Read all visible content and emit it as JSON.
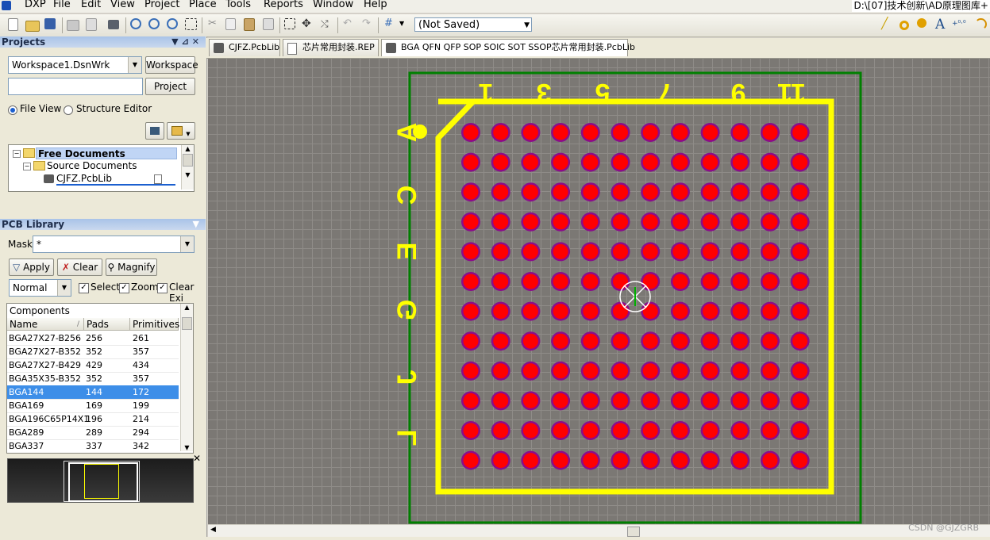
{
  "menubar": {
    "items": [
      "DXP",
      "File",
      "Edit",
      "View",
      "Project",
      "Place",
      "Tools",
      "Reports",
      "Window",
      "Help"
    ],
    "path": "D:\\[07]技术创新\\AD原理图库+"
  },
  "toolbar": {
    "status_value": "(Not Saved)"
  },
  "projects_panel": {
    "title": "Projects",
    "workspace_value": "Workspace1.DsnWrk",
    "workspace_button": "Workspace",
    "project_value": "",
    "project_button": "Project",
    "view_options": [
      "File View",
      "Structure Editor"
    ],
    "selected_view": "File View",
    "tree": [
      {
        "label": "Free Documents"
      },
      {
        "label": "Source Documents"
      },
      {
        "label": "CJFZ.PcbLib"
      }
    ]
  },
  "pcb_library_panel": {
    "title": "PCB Library",
    "mask_label": "Mask",
    "mask_value": "*",
    "apply_label": "Apply",
    "clear_label": "Clear",
    "magnify_label": "Magnify",
    "mode_value": "Normal",
    "checks": [
      {
        "label": "Select",
        "checked": true
      },
      {
        "label": "Zoom",
        "checked": true
      },
      {
        "label": "Clear Exi",
        "checked": true
      }
    ],
    "components_header": "Components",
    "columns": [
      "Name",
      "Pads",
      "Primitives"
    ],
    "rows": [
      {
        "name": "BGA27X27-B256",
        "pads": "256",
        "primitives": "261"
      },
      {
        "name": "BGA27X27-B352",
        "pads": "352",
        "primitives": "357"
      },
      {
        "name": "BGA27X27-B429",
        "pads": "429",
        "primitives": "434"
      },
      {
        "name": "BGA35X35-B352",
        "pads": "352",
        "primitives": "357"
      },
      {
        "name": "BGA144",
        "pads": "144",
        "primitives": "172"
      },
      {
        "name": "BGA169",
        "pads": "169",
        "primitives": "199"
      },
      {
        "name": "BGA196C65P14X1",
        "pads": "196",
        "primitives": "214"
      },
      {
        "name": "BGA289",
        "pads": "289",
        "primitives": "294"
      },
      {
        "name": "BGA337",
        "pads": "337",
        "primitives": "342"
      }
    ],
    "selected_row": "BGA144"
  },
  "tabs": [
    {
      "label": "CJFZ.PcbLib"
    },
    {
      "label": "芯片常用封装.REP"
    },
    {
      "label": "BGA QFN QFP SOP SOIC SOT SSOP芯片常用封装.PcbLib"
    }
  ],
  "pcb": {
    "column_labels": [
      "1",
      "3",
      "5",
      "7",
      "9",
      "11"
    ],
    "row_labels": [
      "A",
      "C",
      "E",
      "G",
      "J",
      "L"
    ],
    "grid": {
      "rows": 12,
      "cols": 12
    },
    "colors": {
      "pad": "#ff0000",
      "pad_ring": "#8b0c8b",
      "silkscreen": "#ffff00",
      "outline": "#008000",
      "background": "#7b7874"
    }
  },
  "watermark": "CSDN @GJZGRB"
}
